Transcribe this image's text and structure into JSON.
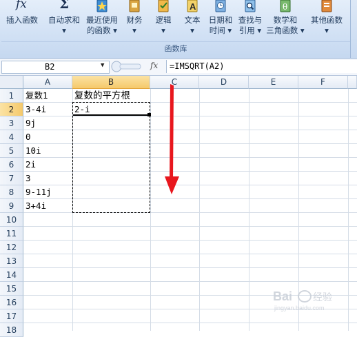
{
  "ribbon": {
    "buttons": [
      {
        "label1": "插入函数",
        "label2": "",
        "icon": "fx-icon"
      },
      {
        "label1": "自动求和",
        "label2": "▾",
        "icon": "sigma-icon"
      },
      {
        "label1": "最近使用",
        "label2": "的函数 ▾",
        "icon": "star-book-icon"
      },
      {
        "label1": "财务",
        "label2": "▾",
        "icon": "finance-book-icon"
      },
      {
        "label1": "逻辑",
        "label2": "▾",
        "icon": "logic-book-icon"
      },
      {
        "label1": "文本",
        "label2": "▾",
        "icon": "text-book-icon"
      },
      {
        "label1": "日期和",
        "label2": "时间 ▾",
        "icon": "datetime-book-icon"
      },
      {
        "label1": "查找与",
        "label2": "引用 ▾",
        "icon": "lookup-book-icon"
      },
      {
        "label1": "数学和",
        "label2": "三角函数 ▾",
        "icon": "math-book-icon"
      },
      {
        "label1": "其他函数",
        "label2": "▾",
        "icon": "more-functions-icon"
      }
    ],
    "group_label": "函数库",
    "fx_glyph": "fx",
    "sigma_glyph": "Σ",
    "theta_glyph": "θ",
    "a_glyph": "A"
  },
  "formula_bar": {
    "name_box": "B2",
    "dropdown": "▼",
    "fx_label": "fx",
    "formula": "=IMSQRT(A2)"
  },
  "columns": [
    "A",
    "B",
    "C",
    "D",
    "E",
    "F"
  ],
  "rows": [
    "1",
    "2",
    "3",
    "4",
    "5",
    "6",
    "7",
    "8",
    "9",
    "10",
    "11",
    "12",
    "13",
    "14",
    "15",
    "16",
    "17",
    "18"
  ],
  "cells": {
    "A": [
      "复数1",
      "3-4i",
      "9j",
      "0",
      "10i",
      "2i",
      "3",
      "9-11j",
      "3+4i"
    ],
    "B": [
      "复数的平方根",
      "2-i"
    ]
  },
  "selection": {
    "active_cell": "B2",
    "column": "B",
    "row": "2"
  },
  "colors": {
    "arrow": "#e8171e",
    "selected_header": "#f5c96b"
  },
  "watermark": {
    "brand": "Bai",
    "brand2": "经验",
    "sub": "jingyan.baidu.com"
  }
}
